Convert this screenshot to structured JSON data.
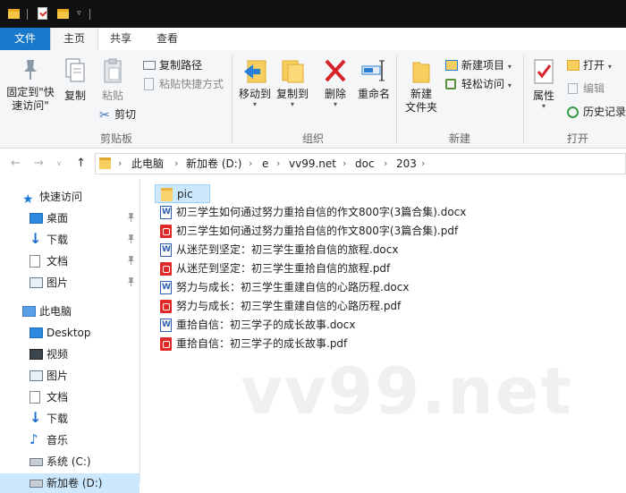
{
  "ribbon": {
    "tabs": [
      "文件",
      "主页",
      "共享",
      "查看"
    ],
    "groups": {
      "clipboard": {
        "label": "剪贴板",
        "pin_label": "固定到\"快速访问\"",
        "copy_label": "复制",
        "paste_label": "粘贴",
        "copy_path": "复制路径",
        "paste_shortcut": "粘贴快捷方式",
        "cut": "剪切"
      },
      "organize": {
        "label": "组织",
        "move_to": "移动到",
        "copy_to": "复制到",
        "delete": "删除",
        "rename": "重命名"
      },
      "new": {
        "label": "新建",
        "new_folder": "新建\n文件夹",
        "new_item": "新建项目",
        "easy_access": "轻松访问"
      },
      "open": {
        "label": "打开",
        "properties": "属性",
        "open": "打开",
        "edit": "编辑",
        "history": "历史记录"
      }
    }
  },
  "address": {
    "crumbs": [
      "此电脑",
      "新加卷 (D:)",
      "e",
      "vv99.net",
      "doc",
      "203"
    ]
  },
  "sidebar": {
    "quick_access": "快速访问",
    "quick_items": [
      "桌面",
      "下载",
      "文档",
      "图片"
    ],
    "this_pc": "此电脑",
    "pc_items": [
      "Desktop",
      "视频",
      "图片",
      "文档",
      "下载",
      "音乐",
      "系统 (C:)",
      "新加卷 (D:)"
    ]
  },
  "files": [
    {
      "name": "pic",
      "type": "folder"
    },
    {
      "name": "初三学生如何通过努力重拾自信的作文800字(3篇合集).docx",
      "type": "docx"
    },
    {
      "name": "初三学生如何通过努力重拾自信的作文800字(3篇合集).pdf",
      "type": "pdf"
    },
    {
      "name": "从迷茫到坚定：初三学生重拾自信的旅程.docx",
      "type": "docx"
    },
    {
      "name": "从迷茫到坚定：初三学生重拾自信的旅程.pdf",
      "type": "pdf"
    },
    {
      "name": "努力与成长：初三学生重建自信的心路历程.docx",
      "type": "docx"
    },
    {
      "name": "努力与成长：初三学生重建自信的心路历程.pdf",
      "type": "pdf"
    },
    {
      "name": "重拾自信：初三学子的成长故事.docx",
      "type": "docx"
    },
    {
      "name": "重拾自信：初三学子的成长故事.pdf",
      "type": "pdf"
    }
  ],
  "watermark": "vv99.net",
  "colors": {
    "accent": "#1979ca",
    "selection": "#cce8ff"
  }
}
